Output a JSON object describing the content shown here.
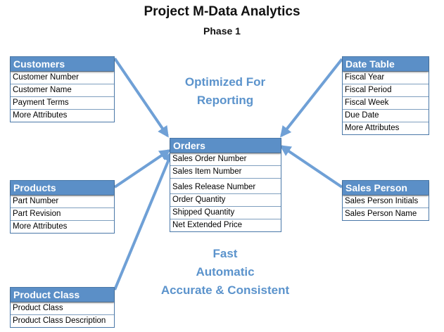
{
  "title": "Project M-Data Analytics",
  "subtitle": "Phase 1",
  "callouts": {
    "top_line1": "Optimized For",
    "top_line2": "Reporting",
    "bottom_line1": "Fast",
    "bottom_line2": "Automatic",
    "bottom_line3": "Accurate & Consistent"
  },
  "entities": {
    "customers": {
      "name": "Customers",
      "fields": [
        "Customer Number",
        "Customer Name",
        "Payment Terms",
        "More Attributes"
      ]
    },
    "date_table": {
      "name": "Date Table",
      "fields": [
        "Fiscal Year",
        "Fiscal Period",
        "Fiscal Week",
        "Due Date",
        "More Attributes"
      ]
    },
    "orders": {
      "name": "Orders",
      "fields": [
        "Sales Order Number",
        "Sales Item Number",
        "Sales Release Number",
        "Order Quantity",
        "Shipped Quantity",
        "Net Extended Price"
      ]
    },
    "products": {
      "name": "Products",
      "fields": [
        "Part Number",
        "Part Revision",
        "More Attributes"
      ]
    },
    "sales_person": {
      "name": "Sales Person",
      "fields": [
        "Sales Person Initials",
        "Sales Person Name"
      ]
    },
    "product_class": {
      "name": "Product Class",
      "fields": [
        "Product Class",
        "Product Class Description"
      ]
    }
  },
  "colors": {
    "header_fill": "#5b8fc7",
    "arrow": "#6fa0d6",
    "callout_text": "#5b93cc",
    "border": "#4a78a8"
  }
}
